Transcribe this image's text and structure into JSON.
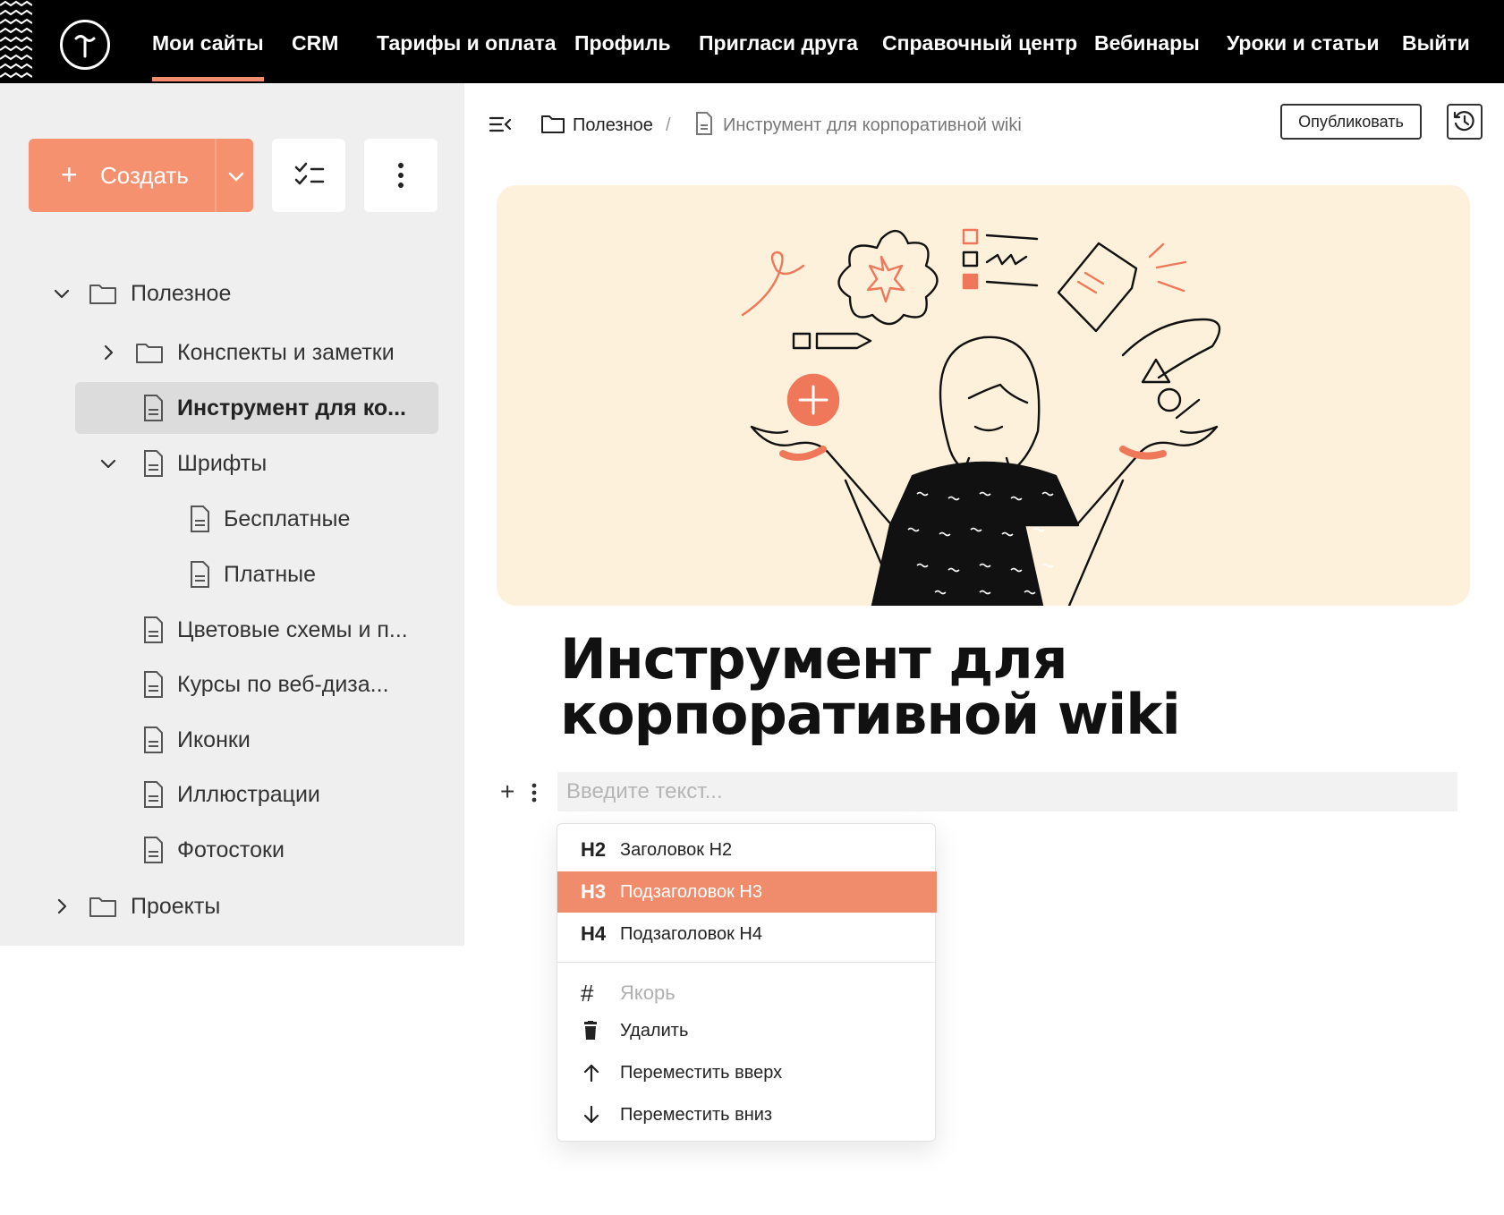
{
  "topnav": {
    "items": [
      {
        "label": "Мои сайты",
        "active": true
      },
      {
        "label": "CRM"
      },
      {
        "label": "Тарифы и оплата"
      },
      {
        "label": "Профиль"
      },
      {
        "label": "Пригласи друга"
      },
      {
        "label": "Справочный центр"
      },
      {
        "label": "Вебинары"
      },
      {
        "label": "Уроки и статьи"
      },
      {
        "label": "Выйти"
      }
    ],
    "logo_icon": "tilda-logo-icon"
  },
  "sidebar": {
    "create_label": "Создать",
    "tree": [
      {
        "label": "Полезное",
        "type": "folder",
        "expanded": true
      },
      {
        "label": "Конспекты и заметки",
        "type": "folder",
        "expanded": false
      },
      {
        "label": "Инструмент для ко...",
        "type": "page",
        "selected": true
      },
      {
        "label": "Шрифты",
        "type": "page",
        "expanded": true
      },
      {
        "label": "Бесплатные",
        "type": "page"
      },
      {
        "label": "Платные",
        "type": "page"
      },
      {
        "label": "Цветовые схемы и п...",
        "type": "page"
      },
      {
        "label": "Курсы по веб-диза...",
        "type": "page"
      },
      {
        "label": "Иконки",
        "type": "page"
      },
      {
        "label": "Иллюстрации",
        "type": "page"
      },
      {
        "label": "Фотостоки",
        "type": "page"
      },
      {
        "label": "Проекты",
        "type": "folder",
        "expanded": false
      }
    ]
  },
  "main": {
    "breadcrumb": {
      "folder": "Полезное",
      "separator": "/",
      "page": "Инструмент для корпоративной wiki"
    },
    "publish_label": "Опубликовать",
    "title": "Инструмент для корпоративной wiki",
    "input_placeholder": "Введите текст...",
    "add_block_symbol": "+"
  },
  "menu": {
    "items": [
      {
        "icon": "H2",
        "label": "Заголовок H2"
      },
      {
        "icon": "H3",
        "label": "Подзаголовок H3",
        "active": true
      },
      {
        "icon": "H4",
        "label": "Подзаголовок H4"
      },
      {
        "icon": "#",
        "label": "Якорь",
        "disabled": true
      },
      {
        "icon": "trash-icon",
        "label": "Удалить"
      },
      {
        "icon": "arrow-up-icon",
        "label": "Переместить вверх"
      },
      {
        "icon": "arrow-down-icon",
        "label": "Переместить вниз"
      }
    ]
  },
  "colors": {
    "accent": "#f5916f",
    "menu_active": "#f08c6c",
    "cover_bg": "#fdf1dc",
    "topbar_bg": "#000000",
    "sidebar_bg": "#efefef"
  }
}
